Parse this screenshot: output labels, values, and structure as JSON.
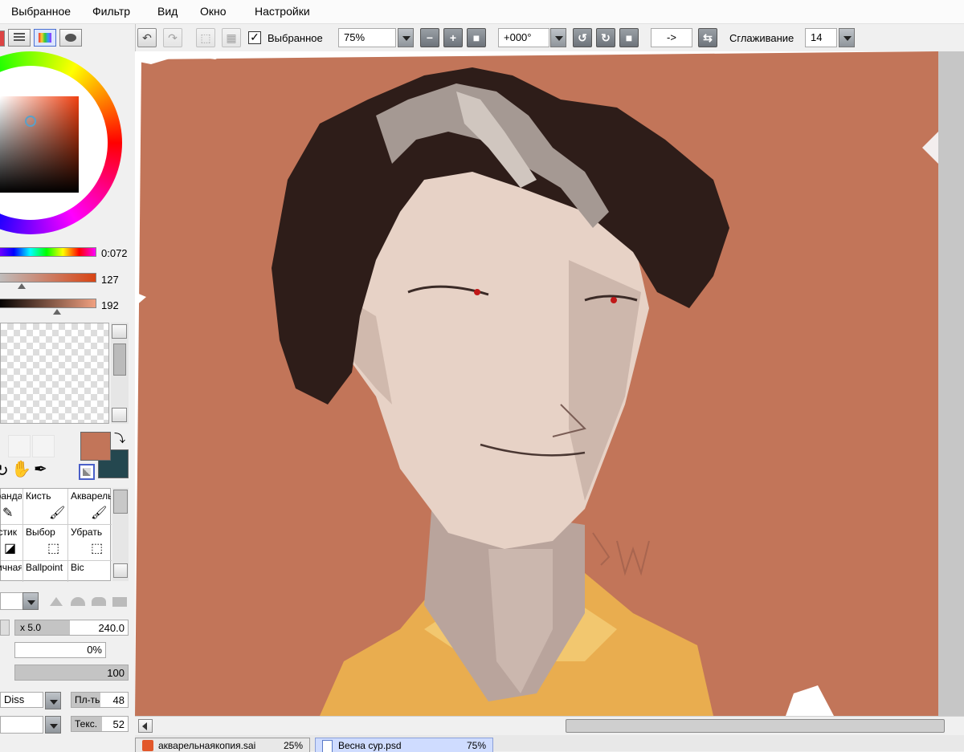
{
  "menu": [
    "Выбранное",
    "Фильтр",
    "Вид",
    "Окно",
    "Настройки"
  ],
  "toolbar": {
    "selected_checkbox_label": "Выбранное",
    "zoom_value": "75%",
    "rotation_value": "+000°",
    "flip_label": "->",
    "smoothing_label": "Сглаживание",
    "smoothing_value": "14"
  },
  "color_panel": {
    "hue_value": "0:072",
    "sat_value": "127",
    "val_value": "192",
    "primary_color": "#c27559",
    "secondary_color": "#24474f"
  },
  "tools": [
    {
      "label": "Карандаш",
      "icon": "pencil-icon"
    },
    {
      "label": "Кисть",
      "icon": "brush-icon"
    },
    {
      "label": "Акварель",
      "icon": "watercolor-icon"
    },
    {
      "label": "Ластик",
      "icon": "eraser-icon"
    },
    {
      "label": "Выбор",
      "icon": "select-icon"
    },
    {
      "label": "Убрать",
      "icon": "deselect-icon"
    },
    {
      "label": "Двоичная",
      "icon": "binary-icon"
    },
    {
      "label": "Ballpoint",
      "icon": "ballpoint-icon"
    },
    {
      "label": "Bic",
      "icon": "bic-icon"
    }
  ],
  "brush": {
    "size_multiplier": "x 5.0",
    "size_value": "240.0",
    "min_size": "0%",
    "density": "100",
    "blend_mode": "Diss",
    "blend_label": "Пл-ть",
    "blend_value": "48",
    "texture_label": "Текс.",
    "texture_value": "52"
  },
  "tabs": [
    {
      "name": "акварельнаякопия.sai",
      "zoom": "25%",
      "active": false
    },
    {
      "name": "Весна сур.psd",
      "zoom": "75%",
      "active": true
    }
  ],
  "colors": {
    "canvas_bg": "#c27559",
    "panel_bg": "#f0f0f0"
  }
}
